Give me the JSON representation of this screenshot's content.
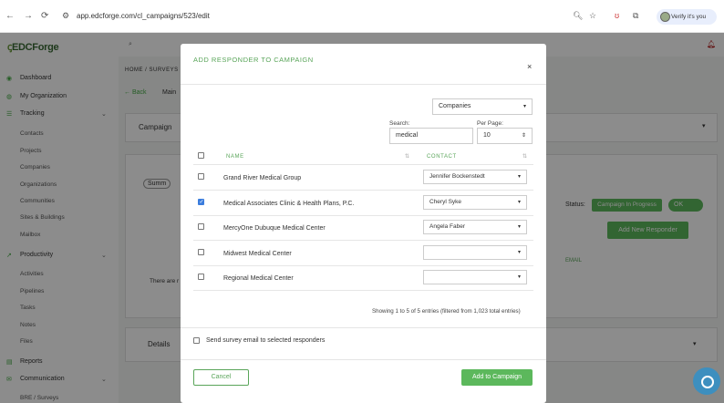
{
  "browser": {
    "url": "app.edcforge.com/cl_campaigns/523/edit",
    "profile_label": "Verify it's you"
  },
  "app": {
    "logo_text": "EDCForge",
    "breadcrumb": "HOME / SURVEYS",
    "back_label": "Back",
    "main_tab": "Main",
    "campaign_label": "Campaign",
    "summary_label": "Summ",
    "status_label": "Status:",
    "status_value": "Campaign In Progress",
    "toggle_label": "OK",
    "add_new_responder_label": "Add New Responder",
    "email_column": "EMAIL",
    "there_are_text": "There are r",
    "details_label": "Details"
  },
  "sidebar": {
    "items": [
      {
        "label": "Dashboard",
        "icon": "dashboard-icon"
      },
      {
        "label": "My Organization",
        "icon": "organization-icon"
      },
      {
        "label": "Tracking",
        "icon": "list-icon"
      },
      {
        "label": "Contacts"
      },
      {
        "label": "Projects"
      },
      {
        "label": "Companies"
      },
      {
        "label": "Organizations"
      },
      {
        "label": "Communities"
      },
      {
        "label": "Sites & Buildings"
      },
      {
        "label": "Mailbox"
      },
      {
        "label": "Productivity",
        "icon": "chart-icon"
      },
      {
        "label": "Activities"
      },
      {
        "label": "Pipelines"
      },
      {
        "label": "Tasks"
      },
      {
        "label": "Notes"
      },
      {
        "label": "Files"
      },
      {
        "label": "Reports",
        "icon": "reports-icon"
      },
      {
        "label": "Communication",
        "icon": "chat-icon"
      },
      {
        "label": "BRE / Surveys"
      }
    ]
  },
  "modal": {
    "title": "ADD RESPONDER TO CAMPAIGN",
    "type_select": "Companies",
    "search_label": "Search:",
    "search_value": "medical",
    "per_page_label": "Per Page:",
    "per_page_value": "10",
    "columns": {
      "name": "NAME",
      "contact": "CONTACT"
    },
    "rows": [
      {
        "name": "Grand River Medical Group",
        "contact": "Jennifer Bockenstedt",
        "checked": false
      },
      {
        "name": "Medical Associates Clinic & Health Plans, P.C.",
        "contact": "Cheryl Syke",
        "checked": true
      },
      {
        "name": "MercyOne Dubuque Medical Center",
        "contact": "Angela Faber",
        "checked": false
      },
      {
        "name": "Midwest Medical Center",
        "contact": "",
        "checked": false
      },
      {
        "name": "Regional Medical Center",
        "contact": "",
        "checked": false
      }
    ],
    "info": "Showing 1 to 5 of 5 entries (filtered from 1,023 total entries)",
    "send_email_label": "Send survey email to selected responders",
    "cancel_label": "Cancel",
    "submit_label": "Add to Campaign"
  },
  "colors": {
    "accent": "#5cb85c",
    "brand": "#3a6b35",
    "checkbox": "#3b7ddd"
  }
}
